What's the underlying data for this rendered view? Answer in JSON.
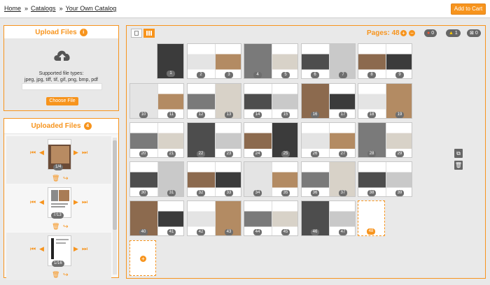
{
  "breadcrumb": {
    "items": [
      "Home",
      "Catalogs",
      "Your Own Catalog"
    ],
    "separator": "»"
  },
  "header": {
    "cart_button": "Add to Cart"
  },
  "upload_panel": {
    "title": "Upload Files",
    "info_badge": "i",
    "icon": "cloud-upload-icon",
    "supported_label": "Supported file types:",
    "file_types": "jpeg, jpg, tiff, tif, gif, png, bmp, pdf",
    "choose_button": "Choose File"
  },
  "uploaded_panel": {
    "title": "Uploaded Files",
    "count": "4",
    "items": [
      {
        "counter": "1/4"
      },
      {
        "counter": "7/13"
      },
      {
        "counter": "1/16"
      }
    ]
  },
  "pages_toolbar": {
    "label": "Pages: 48",
    "add_icon": "+",
    "remove_icon": "−",
    "error_count": "0",
    "warning_count": "1",
    "empty_count": "0"
  },
  "pages": {
    "total": 48,
    "numbers": [
      "1",
      "2",
      "3",
      "4",
      "5",
      "6",
      "7",
      "8",
      "9",
      "10",
      "11",
      "12",
      "13",
      "14",
      "15",
      "16",
      "17",
      "18",
      "19",
      "20",
      "21",
      "22",
      "23",
      "24",
      "25",
      "26",
      "27",
      "28",
      "29",
      "30",
      "31",
      "32",
      "33",
      "34",
      "35",
      "36",
      "37",
      "38",
      "39",
      "40",
      "41",
      "42",
      "43",
      "44",
      "45",
      "46",
      "47",
      "48"
    ],
    "highlighted": "48",
    "empty_page": "48"
  },
  "colors": {
    "accent": "#f7941d",
    "badge": "#6e6e6e",
    "background": "#e9e9e9"
  }
}
